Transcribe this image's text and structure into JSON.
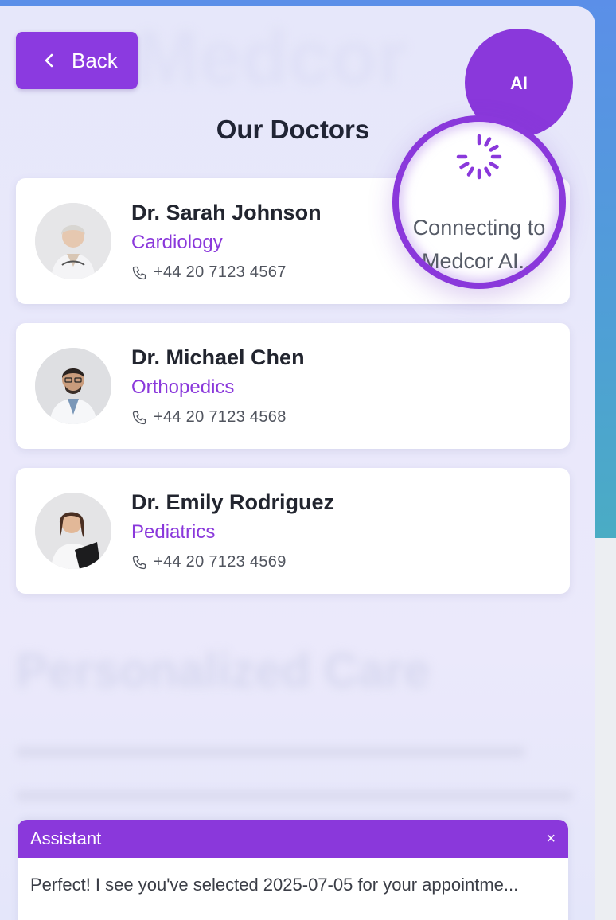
{
  "header": {
    "back_label": "Back",
    "page_title": "Our Doctors",
    "background_word": "Medcor",
    "background_heading": "Personalized Care"
  },
  "ai": {
    "button_label": "AI",
    "connecting_line1": "Connecting to",
    "connecting_line2": "Medcor AI..."
  },
  "doctors": [
    {
      "name": "Dr. Sarah Johnson",
      "specialty": "Cardiology",
      "phone": "+44 20 7123 4567"
    },
    {
      "name": "Dr. Michael Chen",
      "specialty": "Orthopedics",
      "phone": "+44 20 7123 4568"
    },
    {
      "name": "Dr. Emily Rodriguez",
      "specialty": "Pediatrics",
      "phone": "+44 20 7123 4569"
    }
  ],
  "assistant": {
    "title": "Assistant",
    "close_label": "×",
    "message": "Perfect! I see you've selected 2025-07-05 for your appointme..."
  },
  "colors": {
    "accent": "#8a38db",
    "title_text": "#202434",
    "panel_bg": "#e8e8fb",
    "outer_gradient_top": "#5b8fe8",
    "outer_gradient_bottom": "#4aacc4"
  },
  "icons": [
    "chevron-left-icon",
    "phone-icon",
    "spinner-icon",
    "close-icon"
  ]
}
